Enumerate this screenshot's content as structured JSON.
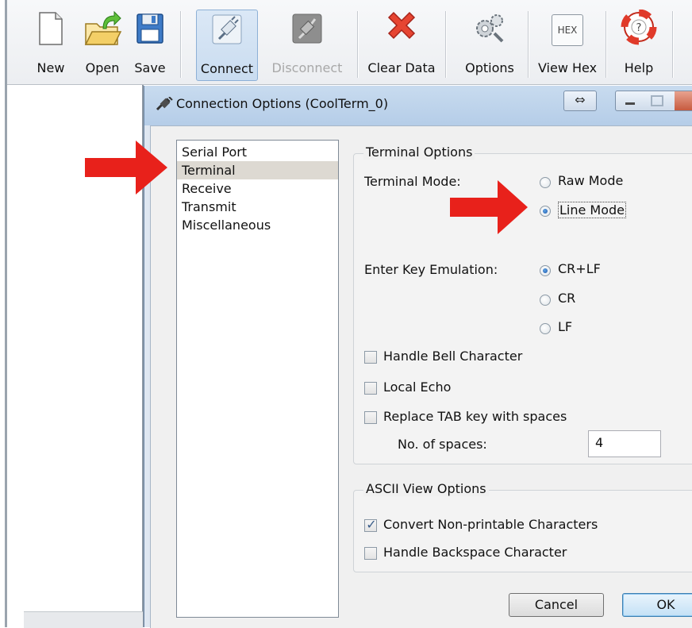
{
  "toolbar": {
    "buttons": [
      {
        "label": "New",
        "icon": "new-document-icon"
      },
      {
        "label": "Open",
        "icon": "open-folder-icon"
      },
      {
        "label": "Save",
        "icon": "floppy-disk-icon"
      },
      {
        "label": "Connect",
        "icon": "connect-plug-icon"
      },
      {
        "label": "Disconnect",
        "icon": "disconnect-plug-icon"
      },
      {
        "label": "Clear Data",
        "icon": "red-x-icon"
      },
      {
        "label": "Options",
        "icon": "gears-icon"
      },
      {
        "label": "View Hex",
        "icon": "hex-icon",
        "icon_text": "HEX"
      },
      {
        "label": "Help",
        "icon": "lifebuoy-icon"
      }
    ]
  },
  "dialog": {
    "title": "Connection Options (CoolTerm_0)",
    "categories": [
      "Serial Port",
      "Terminal",
      "Receive",
      "Transmit",
      "Miscellaneous"
    ],
    "selected_category": "Terminal",
    "terminal_options": {
      "group_title": "Terminal Options",
      "terminal_mode_label": "Terminal Mode:",
      "raw_mode": "Raw Mode",
      "line_mode": "Line Mode",
      "selected_mode": "Line Mode",
      "enter_key_label": "Enter Key Emulation:",
      "crlf": "CR+LF",
      "cr": "CR",
      "lf": "LF",
      "selected_enter": "CR+LF",
      "handle_bell": "Handle Bell Character",
      "local_echo": "Local Echo",
      "replace_tab": "Replace TAB key with spaces",
      "num_spaces_label": "No. of spaces:",
      "num_spaces_value": "4"
    },
    "ascii_options": {
      "group_title": "ASCII View Options",
      "convert_nonprintable": "Convert Non-printable Characters",
      "convert_checked": true,
      "handle_backspace": "Handle Backspace Character"
    },
    "cancel_label": "Cancel",
    "ok_label": "OK"
  },
  "colors": {
    "accent_red": "#e8211b",
    "radio_selected": "#1c56a8",
    "titlebar": "#b5cde8"
  }
}
